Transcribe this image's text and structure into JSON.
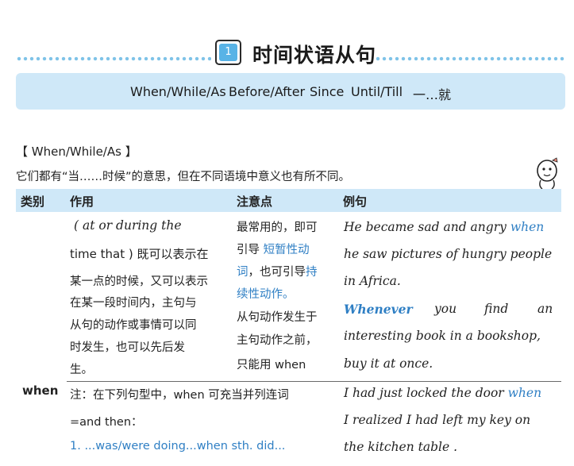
{
  "section": {
    "number": "1",
    "title": "时间状语从句"
  },
  "banner": {
    "items": [
      "When/While/As",
      "Before/After",
      "Since",
      "Until/Till",
      "一…就"
    ]
  },
  "subsection": {
    "heading": "【 When/While/As 】",
    "intro": "它们都有“当……时候”的意思，但在不同语境中意义也有所不同。"
  },
  "table": {
    "headers": [
      "类别",
      "作用",
      "注意点",
      "例句"
    ],
    "category": "when",
    "row1": {
      "usage_lines": [
        "( at or during the",
        "time that ) 既可以表示在",
        "某一点的时候，又可以表示",
        "在某一段时间内，主句与",
        "从句的动作或事情可以同",
        "时发生，也可以先后发",
        "生。"
      ],
      "note": {
        "l1": "最常用的，即可",
        "l2a": "引导",
        "l2b": "短暂性动",
        "l3a": "词",
        "l3b": "，也可引导",
        "l3c": "持",
        "l4": "续性动作。",
        "l5": "从句动作发生于",
        "l6": "主句动作之前，",
        "l7": "只能用 when"
      },
      "example": {
        "l1a": "He became sad and angry",
        "l1b": "when",
        "l2": "he saw pictures of hungry people",
        "l3": "in Africa.",
        "l4a": "Whenever",
        "l4b": "you",
        "l4c": "find",
        "l4d": "an",
        "l5": "interesting book in a bookshop,",
        "l6": "buy it at once."
      }
    },
    "row2": {
      "usage_l1": "注：在下列句型中，when 可充当并列连词",
      "usage_l2": "=and then：",
      "usage_l3": "1. ...was/were doing...when sth. did...",
      "example": {
        "l1a": "I had just locked the door",
        "l1b": "when",
        "l2": "I realized I had left my key on",
        "l3": "the kitchen table ."
      }
    }
  },
  "colors": {
    "accent": "#58b3e6",
    "banner_bg": "#cfe8f8",
    "highlight": "#2f7fc4"
  },
  "icons": [
    "cartoon-character-icon"
  ]
}
